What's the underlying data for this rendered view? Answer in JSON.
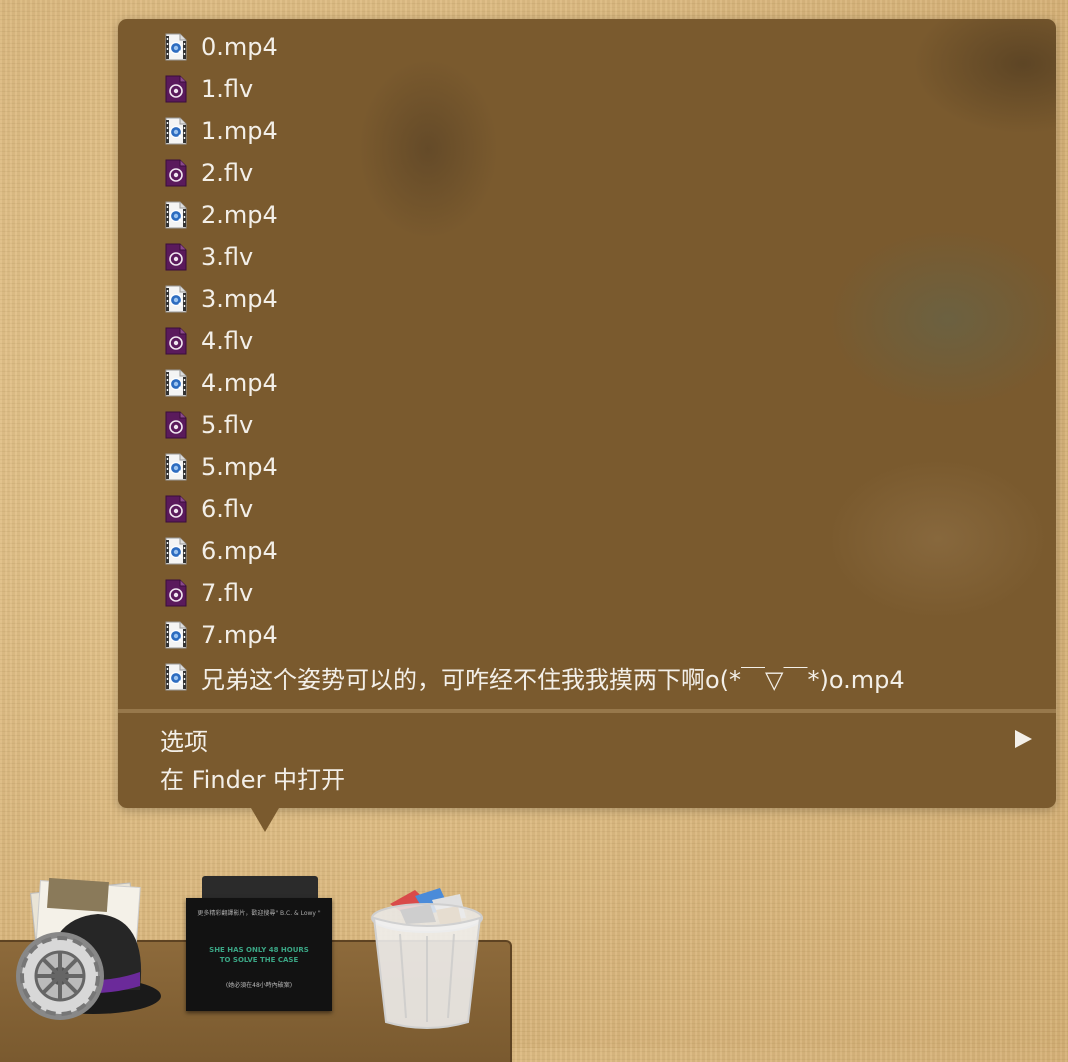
{
  "stack": {
    "files": [
      {
        "name": "0.mp4",
        "icon": "quicktime-movie-icon"
      },
      {
        "name": "1.flv",
        "icon": "flv-video-icon"
      },
      {
        "name": "1.mp4",
        "icon": "quicktime-movie-icon"
      },
      {
        "name": "2.flv",
        "icon": "flv-video-icon"
      },
      {
        "name": "2.mp4",
        "icon": "quicktime-movie-icon"
      },
      {
        "name": "3.flv",
        "icon": "flv-video-icon"
      },
      {
        "name": "3.mp4",
        "icon": "quicktime-movie-icon"
      },
      {
        "name": "4.flv",
        "icon": "flv-video-icon"
      },
      {
        "name": "4.mp4",
        "icon": "quicktime-movie-icon"
      },
      {
        "name": "5.flv",
        "icon": "flv-video-icon"
      },
      {
        "name": "5.mp4",
        "icon": "quicktime-movie-icon"
      },
      {
        "name": "6.flv",
        "icon": "flv-video-icon"
      },
      {
        "name": "6.mp4",
        "icon": "quicktime-movie-icon"
      },
      {
        "name": "7.flv",
        "icon": "flv-video-icon"
      },
      {
        "name": "7.mp4",
        "icon": "quicktime-movie-icon"
      },
      {
        "name": "兄弟这个姿势可以的，可咋经不住我我摸两下啊o(*￣▽￣*)o.mp4",
        "icon": "quicktime-movie-icon"
      }
    ],
    "menu": {
      "options_label": "选项",
      "open_in_finder_label": "在 Finder 中打开"
    }
  },
  "dock": {
    "apps": [
      {
        "name": "alfred",
        "icon": "alfred-bowler-hat-icon"
      },
      {
        "name": "downloads-stack",
        "icon": "folder-stack-icon"
      },
      {
        "name": "trash",
        "icon": "trash-full-icon"
      }
    ],
    "poster_text": {
      "line1": "更多精彩翻譯影片，歡迎搜尋\" B.C. & Lowy \"",
      "line2": "SHE HAS ONLY 48 HOURS",
      "line3": "TO SOLVE THE CASE",
      "line4": "(她必須在48小時內破案)"
    }
  },
  "colors": {
    "popup_background": "#7a5a2e",
    "text": "#f3efe8",
    "flv_icon_purple": "#5a1a5c"
  }
}
